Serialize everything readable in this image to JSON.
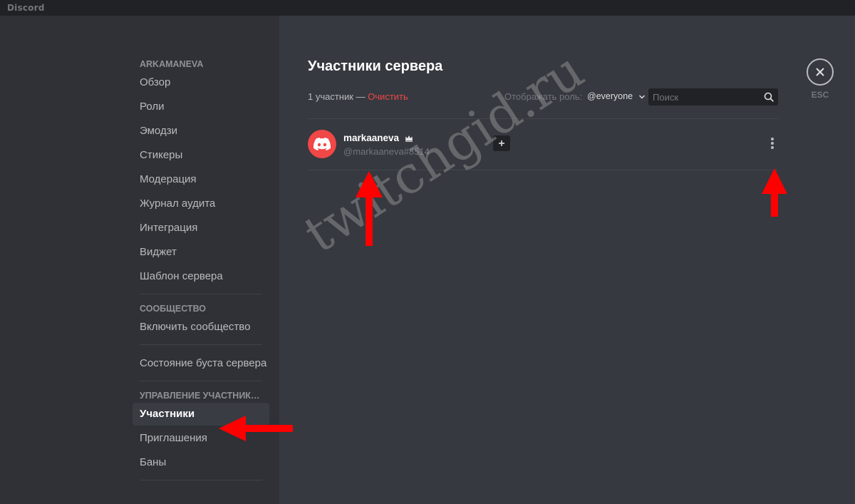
{
  "titlebar": {
    "app_name": "Discord"
  },
  "sidebar": {
    "server_header": "ARKAMANEVA",
    "server_items": [
      {
        "label": "Обзор"
      },
      {
        "label": "Роли"
      },
      {
        "label": "Эмодзи"
      },
      {
        "label": "Стикеры"
      },
      {
        "label": "Модерация"
      },
      {
        "label": "Журнал аудита"
      },
      {
        "label": "Интеграция"
      },
      {
        "label": "Виджет"
      },
      {
        "label": "Шаблон сервера"
      }
    ],
    "community_header": "СООБЩЕСТВО",
    "community_items": [
      {
        "label": "Включить сообщество"
      }
    ],
    "boost_item": "Состояние буста сервера",
    "members_header": "УПРАВЛЕНИЕ УЧАСТНИКА...",
    "members_items": [
      {
        "label": "Участники",
        "active": true
      },
      {
        "label": "Приглашения"
      },
      {
        "label": "Баны"
      }
    ]
  },
  "main": {
    "title": "Участники сервера",
    "member_count": "1 участник —",
    "clear_label": "Очистить",
    "role_filter_label": "Отображать роль:",
    "role_selected": "@everyone",
    "search": {
      "placeholder": "Поиск",
      "value": ""
    },
    "members": [
      {
        "name": "markaaneva",
        "tag": "@markaaneva#8514",
        "owner": true
      }
    ]
  },
  "close": {
    "esc_label": "ESC"
  },
  "watermark": "twitchgid.ru",
  "colors": {
    "accent_red": "#f04747",
    "sidebar_bg": "#2f3136",
    "content_bg": "#36393f",
    "titlebar_bg": "#202225",
    "arrow_red": "#ff0000"
  }
}
